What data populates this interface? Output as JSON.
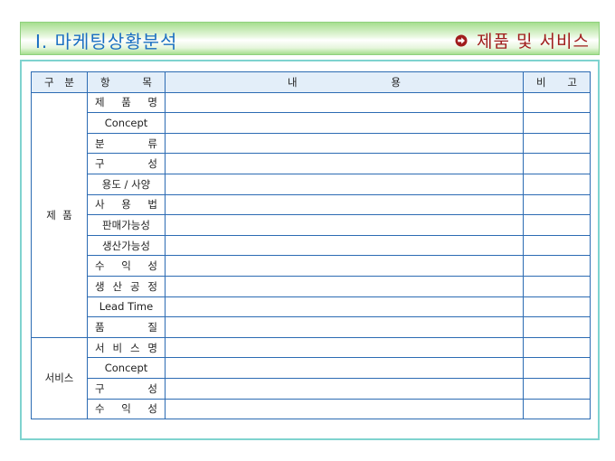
{
  "header": {
    "title": "Ⅰ. 마케팅상황분석",
    "section": "제품 및 서비스"
  },
  "table": {
    "columns": {
      "group": [
        "구",
        "분"
      ],
      "item": [
        "항",
        "목"
      ],
      "content": [
        "내",
        "용"
      ],
      "note": [
        "비",
        "고"
      ]
    },
    "groups": [
      {
        "label": "제  품",
        "rows": [
          {
            "chars": [
              "제",
              "품",
              "명"
            ]
          },
          {
            "text": "Concept"
          },
          {
            "chars": [
              "분",
              "류"
            ]
          },
          {
            "chars": [
              "구",
              "성"
            ]
          },
          {
            "text": "용도 / 사양"
          },
          {
            "chars": [
              "사",
              "용",
              "법"
            ]
          },
          {
            "text": "판매가능성"
          },
          {
            "text": "생산가능성"
          },
          {
            "chars": [
              "수",
              "익",
              "성"
            ]
          },
          {
            "chars": [
              "생",
              "산",
              "공",
              "정"
            ]
          },
          {
            "text": "Lead Time"
          },
          {
            "chars": [
              "품",
              "질"
            ]
          }
        ]
      },
      {
        "label": "서비스",
        "rows": [
          {
            "chars": [
              "서",
              "비",
              "스",
              "명"
            ]
          },
          {
            "text": "Concept"
          },
          {
            "chars": [
              "구",
              "성"
            ]
          },
          {
            "chars": [
              "수",
              "익",
              "성"
            ]
          }
        ]
      }
    ]
  },
  "colors": {
    "title": "#1b6fc2",
    "section": "#a01c1c",
    "grid": "#2c6bb3",
    "box_border": "#7fd3cf",
    "bar_green": "#a6de8e"
  }
}
